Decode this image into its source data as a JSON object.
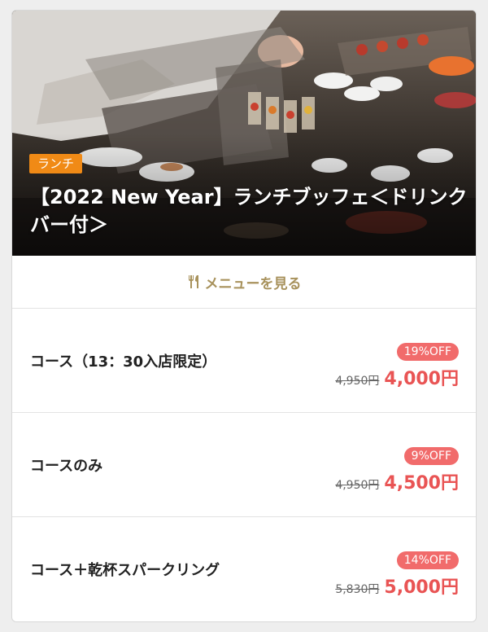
{
  "hero": {
    "tag": "ランチ",
    "title": "【2022 New Year】ランチブッフェ＜ドリンクバー付＞"
  },
  "menu_link": {
    "label": "メニューを見る",
    "icon": "fork-knife-icon"
  },
  "courses": [
    {
      "name": "コース（13：30入店限定）",
      "discount": "19%OFF",
      "original_price": "4,950円",
      "price": "4,000円"
    },
    {
      "name": "コースのみ",
      "discount": "9%OFF",
      "original_price": "4,950円",
      "price": "4,500円"
    },
    {
      "name": "コース＋乾杯スパークリング",
      "discount": "14%OFF",
      "original_price": "5,830円",
      "price": "5,000円"
    }
  ],
  "colors": {
    "tag_bg": "#f08a16",
    "accent_gold": "#a8925c",
    "discount_badge": "#f16b6b",
    "price": "#e95454"
  }
}
